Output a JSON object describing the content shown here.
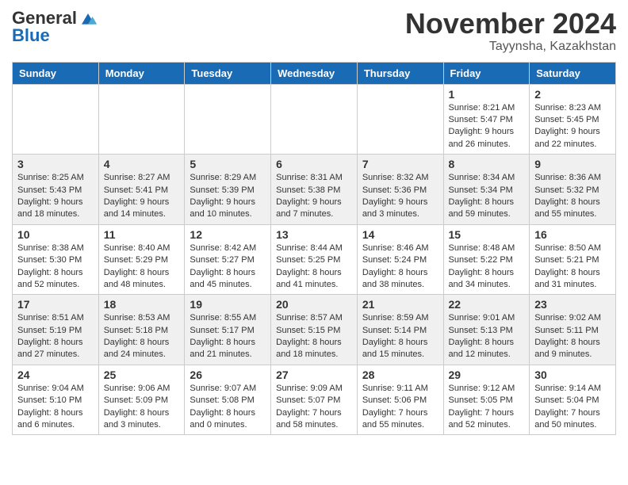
{
  "logo": {
    "general": "General",
    "blue": "Blue"
  },
  "header": {
    "month": "November 2024",
    "location": "Tayynsha, Kazakhstan"
  },
  "weekdays": [
    "Sunday",
    "Monday",
    "Tuesday",
    "Wednesday",
    "Thursday",
    "Friday",
    "Saturday"
  ],
  "weeks": [
    [
      {
        "day": "",
        "info": ""
      },
      {
        "day": "",
        "info": ""
      },
      {
        "day": "",
        "info": ""
      },
      {
        "day": "",
        "info": ""
      },
      {
        "day": "",
        "info": ""
      },
      {
        "day": "1",
        "info": "Sunrise: 8:21 AM\nSunset: 5:47 PM\nDaylight: 9 hours and 26 minutes."
      },
      {
        "day": "2",
        "info": "Sunrise: 8:23 AM\nSunset: 5:45 PM\nDaylight: 9 hours and 22 minutes."
      }
    ],
    [
      {
        "day": "3",
        "info": "Sunrise: 8:25 AM\nSunset: 5:43 PM\nDaylight: 9 hours and 18 minutes."
      },
      {
        "day": "4",
        "info": "Sunrise: 8:27 AM\nSunset: 5:41 PM\nDaylight: 9 hours and 14 minutes."
      },
      {
        "day": "5",
        "info": "Sunrise: 8:29 AM\nSunset: 5:39 PM\nDaylight: 9 hours and 10 minutes."
      },
      {
        "day": "6",
        "info": "Sunrise: 8:31 AM\nSunset: 5:38 PM\nDaylight: 9 hours and 7 minutes."
      },
      {
        "day": "7",
        "info": "Sunrise: 8:32 AM\nSunset: 5:36 PM\nDaylight: 9 hours and 3 minutes."
      },
      {
        "day": "8",
        "info": "Sunrise: 8:34 AM\nSunset: 5:34 PM\nDaylight: 8 hours and 59 minutes."
      },
      {
        "day": "9",
        "info": "Sunrise: 8:36 AM\nSunset: 5:32 PM\nDaylight: 8 hours and 55 minutes."
      }
    ],
    [
      {
        "day": "10",
        "info": "Sunrise: 8:38 AM\nSunset: 5:30 PM\nDaylight: 8 hours and 52 minutes."
      },
      {
        "day": "11",
        "info": "Sunrise: 8:40 AM\nSunset: 5:29 PM\nDaylight: 8 hours and 48 minutes."
      },
      {
        "day": "12",
        "info": "Sunrise: 8:42 AM\nSunset: 5:27 PM\nDaylight: 8 hours and 45 minutes."
      },
      {
        "day": "13",
        "info": "Sunrise: 8:44 AM\nSunset: 5:25 PM\nDaylight: 8 hours and 41 minutes."
      },
      {
        "day": "14",
        "info": "Sunrise: 8:46 AM\nSunset: 5:24 PM\nDaylight: 8 hours and 38 minutes."
      },
      {
        "day": "15",
        "info": "Sunrise: 8:48 AM\nSunset: 5:22 PM\nDaylight: 8 hours and 34 minutes."
      },
      {
        "day": "16",
        "info": "Sunrise: 8:50 AM\nSunset: 5:21 PM\nDaylight: 8 hours and 31 minutes."
      }
    ],
    [
      {
        "day": "17",
        "info": "Sunrise: 8:51 AM\nSunset: 5:19 PM\nDaylight: 8 hours and 27 minutes."
      },
      {
        "day": "18",
        "info": "Sunrise: 8:53 AM\nSunset: 5:18 PM\nDaylight: 8 hours and 24 minutes."
      },
      {
        "day": "19",
        "info": "Sunrise: 8:55 AM\nSunset: 5:17 PM\nDaylight: 8 hours and 21 minutes."
      },
      {
        "day": "20",
        "info": "Sunrise: 8:57 AM\nSunset: 5:15 PM\nDaylight: 8 hours and 18 minutes."
      },
      {
        "day": "21",
        "info": "Sunrise: 8:59 AM\nSunset: 5:14 PM\nDaylight: 8 hours and 15 minutes."
      },
      {
        "day": "22",
        "info": "Sunrise: 9:01 AM\nSunset: 5:13 PM\nDaylight: 8 hours and 12 minutes."
      },
      {
        "day": "23",
        "info": "Sunrise: 9:02 AM\nSunset: 5:11 PM\nDaylight: 8 hours and 9 minutes."
      }
    ],
    [
      {
        "day": "24",
        "info": "Sunrise: 9:04 AM\nSunset: 5:10 PM\nDaylight: 8 hours and 6 minutes."
      },
      {
        "day": "25",
        "info": "Sunrise: 9:06 AM\nSunset: 5:09 PM\nDaylight: 8 hours and 3 minutes."
      },
      {
        "day": "26",
        "info": "Sunrise: 9:07 AM\nSunset: 5:08 PM\nDaylight: 8 hours and 0 minutes."
      },
      {
        "day": "27",
        "info": "Sunrise: 9:09 AM\nSunset: 5:07 PM\nDaylight: 7 hours and 58 minutes."
      },
      {
        "day": "28",
        "info": "Sunrise: 9:11 AM\nSunset: 5:06 PM\nDaylight: 7 hours and 55 minutes."
      },
      {
        "day": "29",
        "info": "Sunrise: 9:12 AM\nSunset: 5:05 PM\nDaylight: 7 hours and 52 minutes."
      },
      {
        "day": "30",
        "info": "Sunrise: 9:14 AM\nSunset: 5:04 PM\nDaylight: 7 hours and 50 minutes."
      }
    ]
  ]
}
